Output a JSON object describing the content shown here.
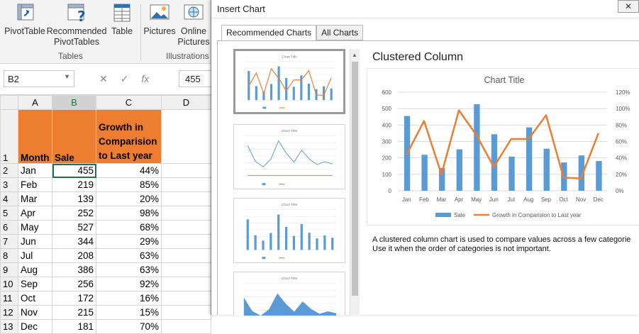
{
  "ribbon": {
    "buttons": [
      "PivotTable",
      "Recommended",
      "PivotTables",
      "Table",
      "Pictures",
      "Online",
      "Pictures"
    ],
    "groups": [
      "Tables",
      "Illustrations"
    ]
  },
  "formula_bar": {
    "name_box": "B2",
    "cancel": "✕",
    "enter": "✓",
    "fx": "fx",
    "value": "455"
  },
  "sheet": {
    "col_headers": [
      "",
      "A",
      "B",
      "C",
      "D"
    ],
    "header_row": {
      "num": "1",
      "a": "Month",
      "b": "Sale",
      "c": "Growth in Comparision to Last year"
    },
    "rows": [
      {
        "num": "2",
        "month": "Jan",
        "sale": "455",
        "growth": "44%"
      },
      {
        "num": "3",
        "month": "Feb",
        "sale": "219",
        "growth": "85%"
      },
      {
        "num": "4",
        "month": "Mar",
        "sale": "139",
        "growth": "20%"
      },
      {
        "num": "5",
        "month": "Apr",
        "sale": "252",
        "growth": "98%"
      },
      {
        "num": "6",
        "month": "May",
        "sale": "527",
        "growth": "68%"
      },
      {
        "num": "7",
        "month": "Jun",
        "sale": "344",
        "growth": "29%"
      },
      {
        "num": "8",
        "month": "Jul",
        "sale": "208",
        "growth": "63%"
      },
      {
        "num": "9",
        "month": "Aug",
        "sale": "386",
        "growth": "63%"
      },
      {
        "num": "10",
        "month": "Sep",
        "sale": "256",
        "growth": "92%"
      },
      {
        "num": "11",
        "month": "Oct",
        "sale": "172",
        "growth": "16%"
      },
      {
        "num": "12",
        "month": "Nov",
        "sale": "215",
        "growth": "15%"
      },
      {
        "num": "13",
        "month": "Dec",
        "sale": "181",
        "growth": "70%"
      }
    ]
  },
  "dialog": {
    "title": "Insert Chart",
    "close": "✕",
    "tabs": [
      "Recommended Charts",
      "All Charts"
    ],
    "preview_heading": "Clustered Column",
    "description_1": "A clustered column chart is used to compare values across a few categorie",
    "description_2": "Use it when the order of categories is not important."
  },
  "colors": {
    "bar": "#5b9bd5",
    "line": "#ed7d31",
    "header_fill": "#ed7d31",
    "selection": "#217346"
  },
  "chart_data": {
    "type": "bar",
    "title": "Chart Title",
    "categories": [
      "Jan",
      "Feb",
      "Mar",
      "Apr",
      "May",
      "Jun",
      "Jul",
      "Aug",
      "Sep",
      "Oct",
      "Nov",
      "Dec"
    ],
    "series": [
      {
        "name": "Sale",
        "type": "bar",
        "axis": "left",
        "values": [
          455,
          219,
          139,
          252,
          527,
          344,
          208,
          386,
          256,
          172,
          215,
          181
        ]
      },
      {
        "name": "Growth in Comparision to Last year",
        "type": "line",
        "axis": "right",
        "values": [
          0.44,
          0.85,
          0.2,
          0.98,
          0.68,
          0.29,
          0.63,
          0.63,
          0.92,
          0.16,
          0.15,
          0.7
        ]
      }
    ],
    "ylim": [
      0,
      600
    ],
    "y_ticks": [
      "0",
      "100",
      "200",
      "300",
      "400",
      "500",
      "600"
    ],
    "y2lim": [
      0,
      1.2
    ],
    "y2_ticks": [
      "0%",
      "20%",
      "40%",
      "60%",
      "80%",
      "100%",
      "120%"
    ],
    "grid": true,
    "legend": "bottom"
  }
}
